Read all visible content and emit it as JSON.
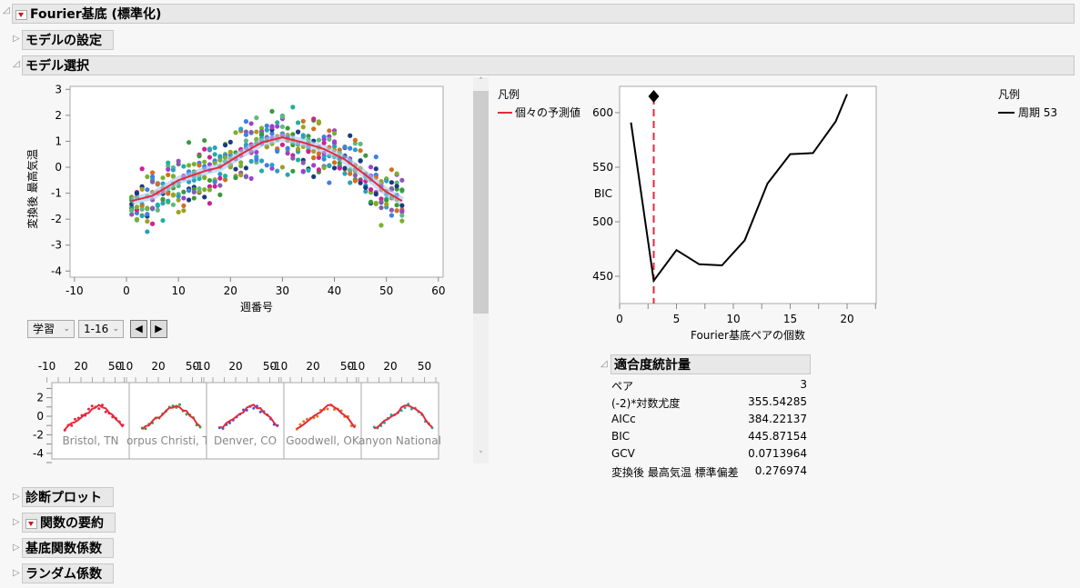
{
  "header": {
    "title": "Fourier基底 (標準化)"
  },
  "sections": {
    "model_settings": "モデルの設定",
    "model_selection": "モデル選択",
    "diagnostic_plot": "診断プロット",
    "function_summary": "関数の要約",
    "basis_coefficients": "基底関数係数",
    "random_coefficients": "ランダム係数"
  },
  "controls": {
    "set_select": "学習",
    "range_select": "1-16"
  },
  "legend_left": {
    "title": "凡例",
    "item": "個々の予測値",
    "color": "#e8283c"
  },
  "legend_right": {
    "title": "凡例",
    "item": "周期 53"
  },
  "fit_stats": {
    "title": "適合度統計量",
    "rows": [
      {
        "label": "ペア",
        "value": "3"
      },
      {
        "label": "(-2)*対数尤度",
        "value": "355.54285"
      },
      {
        "label": "AICc",
        "value": "384.22137"
      },
      {
        "label": "BIC",
        "value": "445.87154"
      },
      {
        "label": "GCV",
        "value": "0.0713964"
      },
      {
        "label": "変換後 最高気温 標準偏差",
        "value": "0.276974"
      }
    ]
  },
  "chart_data": [
    {
      "type": "scatter",
      "xlabel": "週番号",
      "ylabel": "変換後 最高気温",
      "xlim": [
        -10,
        60
      ],
      "ylim": [
        -4,
        3
      ],
      "xticks": [
        "-10",
        "0",
        "10",
        "20",
        "30",
        "40",
        "50",
        "60"
      ],
      "yticks": [
        "3",
        "2",
        "1",
        "0",
        "-1",
        "-2",
        "-3",
        "-4"
      ],
      "fit_line": {
        "x": [
          1,
          5,
          10,
          15,
          18,
          22,
          26,
          30,
          34,
          38,
          42,
          46,
          50,
          53
        ],
        "y": [
          -1.3,
          -1.1,
          -0.5,
          -0.15,
          0,
          0.5,
          0.95,
          1.15,
          0.95,
          0.7,
          0.3,
          -0.3,
          -0.95,
          -1.3
        ]
      }
    },
    {
      "type": "line",
      "xlabel": "Fourier基底ペアの個数",
      "ylabel": "BIC",
      "xlim": [
        0,
        22.5
      ],
      "ylim": [
        425,
        625
      ],
      "xticks": [
        "0",
        "5",
        "10",
        "15",
        "20"
      ],
      "yticks": [
        "600",
        "550",
        "500",
        "450"
      ],
      "x": [
        1,
        3,
        5,
        7,
        9,
        11,
        13,
        15,
        17,
        19,
        20
      ],
      "y": [
        591,
        446,
        474,
        461,
        460,
        483,
        535,
        562,
        563,
        592,
        617
      ],
      "selected_x": 3
    },
    {
      "type": "line",
      "panels": [
        "Bristol, TN",
        "orpus Christi, T",
        "Denver, CO",
        "Goodwell, OK",
        "anyon National"
      ],
      "panel_colors": [
        "#e8283c",
        "#3aa03a",
        "#3a5adc",
        "#d87a20",
        "#20b090"
      ],
      "xticks": [
        "-10",
        "20",
        "50"
      ],
      "yticks": [
        "2",
        "0",
        "-2",
        "-4"
      ]
    }
  ]
}
